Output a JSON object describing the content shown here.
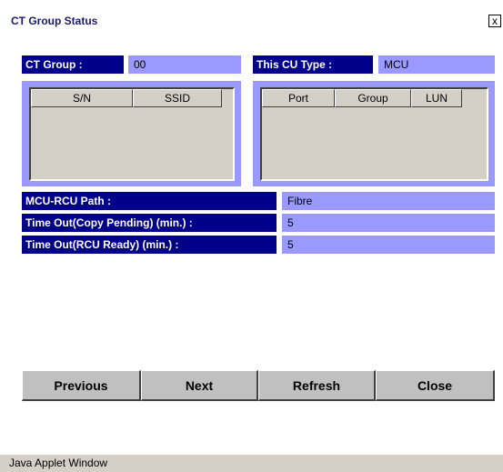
{
  "window": {
    "title": "CT Group Status",
    "close_symbol": "x"
  },
  "ct_group": {
    "label": "CT Group :",
    "value": "00"
  },
  "cu_type": {
    "label": "This CU Type :",
    "value": "MCU"
  },
  "left_list": {
    "columns": [
      "S/N",
      "SSID"
    ]
  },
  "right_list": {
    "columns": [
      "Port",
      "Group",
      "LUN"
    ]
  },
  "details": [
    {
      "label": "MCU-RCU Path :",
      "value": "Fibre"
    },
    {
      "label": "Time Out(Copy Pending) (min.) :",
      "value": "5"
    },
    {
      "label": "Time Out(RCU Ready) (min.) :",
      "value": "5"
    }
  ],
  "buttons": {
    "previous": "Previous",
    "next": "Next",
    "refresh": "Refresh",
    "close": "Close"
  },
  "status_bar": "Java Applet Window",
  "colors": {
    "label_bg": "#00008b",
    "value_bg": "#9999ff",
    "list_bg": "#d4d0c8",
    "button_bg": "#c0c0c0"
  }
}
